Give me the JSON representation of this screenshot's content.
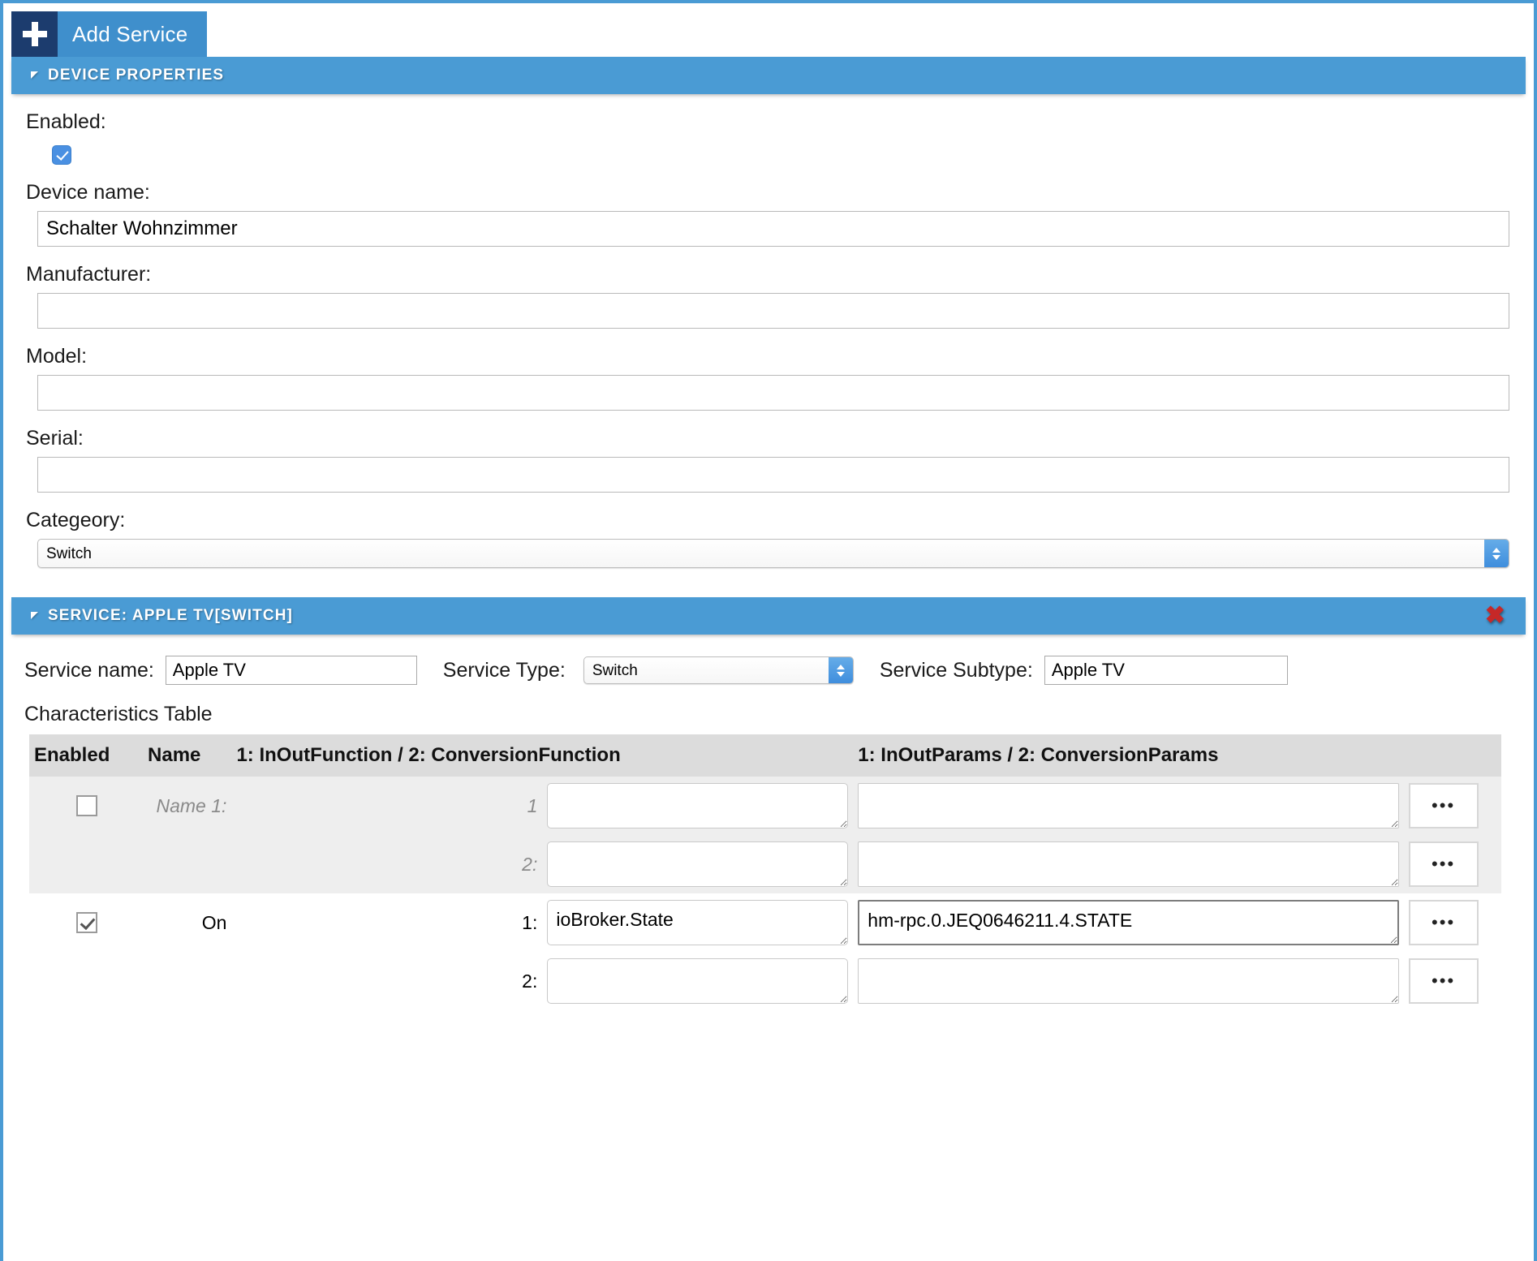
{
  "toolbar": {
    "add_service_label": "Add Service",
    "plus_icon": "plus-icon"
  },
  "device_properties": {
    "header": "DEVICE PROPERTIES",
    "fields": {
      "enabled_label": "Enabled:",
      "enabled_checked": true,
      "device_name_label": "Device name:",
      "device_name_value": "Schalter Wohnzimmer",
      "manufacturer_label": "Manufacturer:",
      "manufacturer_value": "",
      "model_label": "Model:",
      "model_value": "",
      "serial_label": "Serial:",
      "serial_value": "",
      "category_label": "Categeory:",
      "category_value": "Switch"
    }
  },
  "service": {
    "header": "SERVICE: APPLE TV[SWITCH]",
    "close_icon": "close-x-icon",
    "service_name_label": "Service name:",
    "service_name_value": "Apple TV",
    "service_type_label": "Service Type:",
    "service_type_value": "Switch",
    "service_subtype_label": "Service Subtype:",
    "service_subtype_value": "Apple TV",
    "characteristics_label": "Characteristics Table",
    "table": {
      "columns": {
        "enabled": "Enabled",
        "name": "Name",
        "function": "1: InOutFunction / 2: ConversionFunction",
        "params": "1: InOutParams / 2: ConversionParams",
        "actions": ""
      },
      "rows": [
        {
          "enabled": false,
          "name": "Name 1:",
          "name_muted": true,
          "index": "1",
          "function": "",
          "params": "",
          "params_focused": false,
          "dots": "•••"
        },
        {
          "enabled": null,
          "name": "",
          "name_muted": true,
          "index": "2:",
          "function": "",
          "params": "",
          "params_focused": false,
          "dots": "•••"
        },
        {
          "enabled": true,
          "name": "On",
          "name_muted": false,
          "index": "1:",
          "function": "ioBroker.State",
          "params": "hm-rpc.0.JEQ0646211.4.STATE",
          "params_focused": true,
          "dots": "•••"
        },
        {
          "enabled": null,
          "name": "",
          "name_muted": false,
          "index": "2:",
          "function": "",
          "params": "",
          "params_focused": false,
          "dots": "•••"
        }
      ]
    }
  },
  "colors": {
    "accent_blue": "#4a9bd4",
    "dark_blue": "#1c3c6e",
    "close_red": "#c62828",
    "header_gray": "#dcdcdc"
  }
}
